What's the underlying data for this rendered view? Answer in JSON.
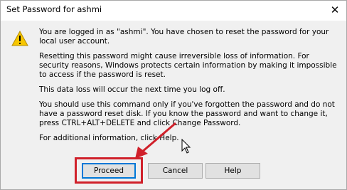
{
  "window": {
    "title": "Set Password for ashmi",
    "close_glyph": "✕"
  },
  "message": {
    "p1": "You are logged in as \"ashmi\". You have chosen to reset the password for your local user account.",
    "p2": "Resetting this password might cause irreversible loss of information. For security reasons, Windows protects certain information by making it impossible to access if the password is reset.",
    "p3": "This data loss will occur the next time you log off.",
    "p4": "You should use this command only if you've forgotten the password and do not have a password reset disk. If you know the password and want to change it, press CTRL+ALT+DELETE and click Change Password.",
    "p5": "For additional information, click Help."
  },
  "buttons": {
    "proceed": "Proceed",
    "cancel": "Cancel",
    "help": "Help"
  },
  "icons": {
    "warning": "warning-icon",
    "close": "close-icon",
    "cursor": "mouse-cursor-icon"
  },
  "colors": {
    "highlight": "#d0202a",
    "focus_border": "#0078d7",
    "warning_fill": "#f7c600"
  }
}
